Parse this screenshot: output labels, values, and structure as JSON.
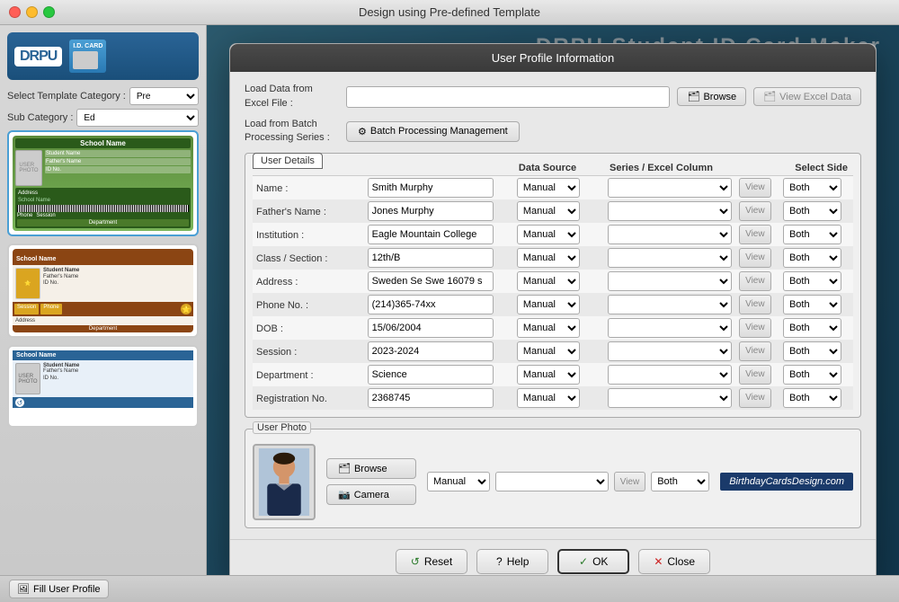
{
  "window": {
    "title": "Design using Pre-defined Template",
    "dialog_title": "User Profile Information"
  },
  "sidebar": {
    "logo": "DRPU",
    "select_template_label": "Select Template Category :",
    "select_template_value": "Pre",
    "sub_category_label": "Sub Category :",
    "sub_category_value": "Ed"
  },
  "dialog": {
    "load_excel_label": "Load Data from\nExcel File :",
    "load_excel_placeholder": "",
    "browse_label": "Browse",
    "view_excel_label": "View Excel Data",
    "load_batch_label": "Load from Batch\nProcessing Series :",
    "batch_btn_label": "Batch Processing Management",
    "group_label": "User Details",
    "columns": {
      "data_source": "Data Source",
      "series_excel": "Series / Excel Column",
      "select_side": "Select Side"
    },
    "rows": [
      {
        "label": "Name :",
        "value": "Smith Murphy",
        "source": "Manual",
        "side": "Both"
      },
      {
        "label": "Father's Name :",
        "value": "Jones Murphy",
        "source": "Manual",
        "side": "Both"
      },
      {
        "label": "Institution :",
        "value": "Eagle Mountain College",
        "source": "Manual",
        "side": "Both"
      },
      {
        "label": "Class / Section :",
        "value": "12th/B",
        "source": "Manual",
        "side": "Both"
      },
      {
        "label": "Address :",
        "value": "Sweden Se Swe 16079 s",
        "source": "Manual",
        "side": "Both"
      },
      {
        "label": "Phone No. :",
        "value": "(214)365-74xx",
        "source": "Manual",
        "side": "Both"
      },
      {
        "label": "DOB :",
        "value": "15/06/2004",
        "source": "Manual",
        "side": "Both"
      },
      {
        "label": "Session :",
        "value": "2023-2024",
        "source": "Manual",
        "side": "Both"
      },
      {
        "label": "Department :",
        "value": "Science",
        "source": "Manual",
        "side": "Both"
      },
      {
        "label": "Registration No.",
        "value": "2368745",
        "source": "Manual",
        "side": "Both"
      }
    ],
    "photo_section_label": "User Photo",
    "photo_browse_label": "Browse",
    "photo_camera_label": "Camera",
    "photo_source": "Manual",
    "photo_side": "Both",
    "watermark": "BirthdayCardsDesign.com",
    "footer": {
      "reset_label": "Reset",
      "help_label": "Help",
      "ok_label": "OK",
      "close_label": "Close"
    }
  },
  "bottom_bar": {
    "fill_profile_label": "Fill User Profile"
  }
}
